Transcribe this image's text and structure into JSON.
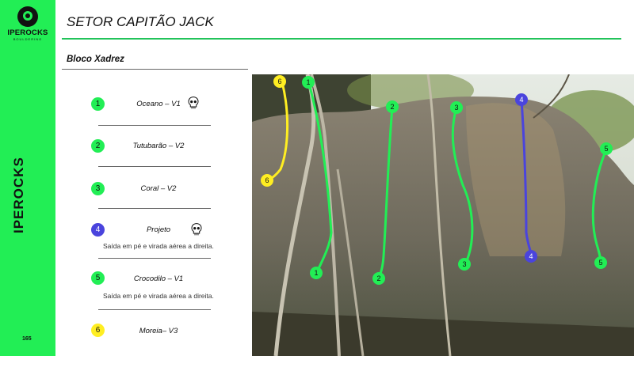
{
  "brand": {
    "name": "IPEROCKS",
    "sub": "BOULDERING",
    "vertical": "IPEROCKS"
  },
  "page_number": "165",
  "sector_title": "SETOR CAPITÃO JACK",
  "bloco_title": "Bloco Xadrez",
  "routes": [
    {
      "number": "1",
      "name": "Oceano – V1",
      "note": "",
      "color": "#22ee55"
    },
    {
      "number": "2",
      "name": "Tutubarão – V2",
      "note": "",
      "color": "#22ee55"
    },
    {
      "number": "3",
      "name": "Coral – V2",
      "note": "",
      "color": "#22ee55"
    },
    {
      "number": "4",
      "name": "Projeto",
      "note": "Saída em pé e virada aérea a direita.",
      "color": "#4a44dd"
    },
    {
      "number": "5",
      "name": "Crocodilo – V1",
      "note": "Saída em pé e virada aérea a direita.",
      "color": "#22ee55"
    },
    {
      "number": "6",
      "name": "Moreia– V3",
      "note": "",
      "color": "#ffee22"
    }
  ],
  "icons": {
    "danger": "skull-icon"
  },
  "colors": {
    "green": "#22ee55",
    "blue": "#4a44dd",
    "yellow": "#ffee22"
  }
}
